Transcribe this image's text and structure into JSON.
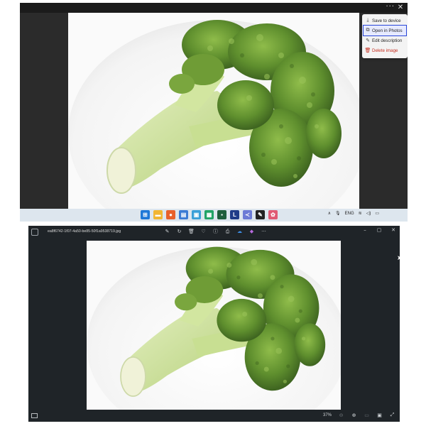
{
  "top_screenshot": {
    "titlebar": {
      "more_label": "···",
      "close_label": "✕"
    },
    "context_menu": {
      "items": [
        {
          "label": "Save to device",
          "icon": "download-icon",
          "glyph": "⤓",
          "state": "normal"
        },
        {
          "label": "Open in Photos",
          "icon": "open-external-icon",
          "glyph": "⧉",
          "state": "highlighted"
        },
        {
          "label": "Edit description",
          "icon": "pencil-icon",
          "glyph": "✎",
          "state": "normal"
        },
        {
          "label": "Delete image",
          "icon": "trash-icon",
          "glyph": "🗑",
          "state": "danger"
        }
      ]
    },
    "taskbar": {
      "apps": [
        {
          "icon": "windows-start-icon",
          "glyph": "⊞",
          "color": "#1e78d7"
        },
        {
          "icon": "file-explorer-icon",
          "glyph": "▬",
          "color": "#f2b632"
        },
        {
          "icon": "firefox-icon",
          "glyph": "●",
          "color": "#e8612c"
        },
        {
          "icon": "document-icon",
          "glyph": "▤",
          "color": "#3b7bd4"
        },
        {
          "icon": "image-app-icon",
          "glyph": "▣",
          "color": "#3aa0d8"
        },
        {
          "icon": "spreadsheet-icon",
          "glyph": "▦",
          "color": "#21a366"
        },
        {
          "icon": "terminal-icon",
          "glyph": "▪",
          "color": "#1e5e3c"
        },
        {
          "icon": "l-app-icon",
          "glyph": "L",
          "color": "#1f3c88"
        },
        {
          "icon": "vscode-like-icon",
          "glyph": "≺",
          "color": "#6c7bd6"
        },
        {
          "icon": "sticky-notes-icon",
          "glyph": "✎",
          "color": "#222222"
        },
        {
          "icon": "paint-icon",
          "glyph": "✿",
          "color": "#e05a74"
        }
      ],
      "tray": {
        "chevron": "∧",
        "mic": "🎙",
        "language": "ENG",
        "wifi": "≋",
        "volume": "◁)",
        "battery": "▭"
      }
    }
  },
  "bottom_screenshot": {
    "filename": "ea8f6742-1f07-4a50-be85-50f1a9538719.jpg",
    "toolbar": [
      {
        "icon": "edit-image-icon",
        "glyph": "✎"
      },
      {
        "icon": "rotate-icon",
        "glyph": "↻"
      },
      {
        "icon": "delete-icon",
        "glyph": "🗑"
      },
      {
        "icon": "favorite-icon",
        "glyph": "♡"
      },
      {
        "icon": "info-icon",
        "glyph": "ⓘ"
      },
      {
        "icon": "print-icon",
        "glyph": "⎙"
      },
      {
        "icon": "onedrive-icon",
        "glyph": "☁"
      },
      {
        "icon": "clipchamp-icon",
        "glyph": "◆"
      },
      {
        "icon": "more-icon",
        "glyph": "···"
      }
    ],
    "window_controls": {
      "minimize": "–",
      "maximize": "▢",
      "close": "✕"
    },
    "status": {
      "zoom": "37%",
      "zoom_out": "⊖",
      "zoom_in": "⊕",
      "fit": "▭",
      "actual_size": "▣",
      "fullscreen": "⤢"
    }
  }
}
